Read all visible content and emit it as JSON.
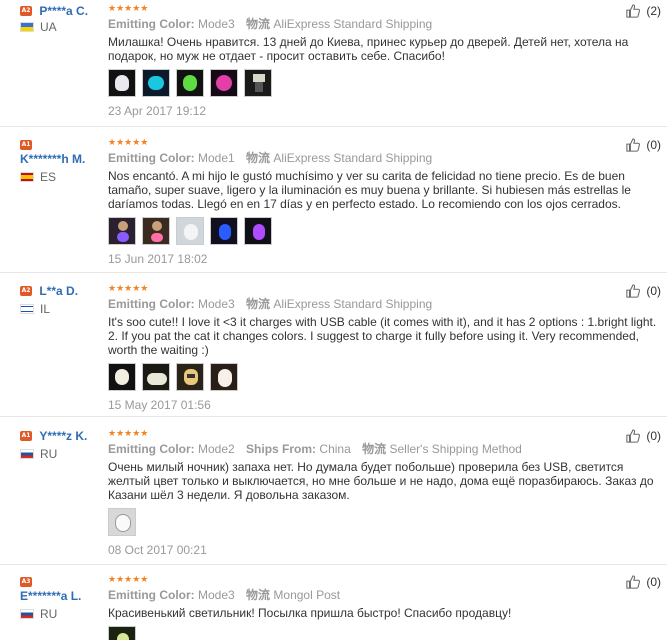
{
  "labels": {
    "emitting_color": "Emitting Color:",
    "ships_from": "Ships From:",
    "logistics_glyph": "物流"
  },
  "reviews": [
    {
      "level": "A2",
      "name": "P****a C.",
      "country": "UA",
      "stars": "★★★★★",
      "color": "Mode3",
      "ships_from": "",
      "shipping": "AliExpress Standard Shipping",
      "text": "Милашка! Очень нравится. 13 дней до Киева, принес курьер до дверей. Детей нет, хотела на подарок, но муж не отдает - просит оставить себе. Спасибо!",
      "thumbs": 5,
      "date": "23 Apr 2017 19:12",
      "helpful": "(2)"
    },
    {
      "level": "A1",
      "name": "K*******h M.",
      "country": "ES",
      "stars": "★★★★★",
      "color": "Mode1",
      "ships_from": "",
      "shipping": "AliExpress Standard Shipping",
      "text": "Nos encantó. A mi hijo le gustó muchísimo y ver su carita de felicidad no tiene precio. Es de buen tamaño, super suave, ligero y la iluminación es muy buena y brillante. Si hubiesen más estrellas le daríamos todas. Llegó en en 17 días y en perfecto estado. Lo recomiendo con los ojos cerrados.",
      "thumbs": 5,
      "date": "15 Jun 2017 18:02",
      "helpful": "(0)"
    },
    {
      "level": "A2",
      "name": "L**a D.",
      "country": "IL",
      "stars": "★★★★★",
      "color": "Mode3",
      "ships_from": "",
      "shipping": "AliExpress Standard Shipping",
      "text": "It's soo cute!! I love it <3 it charges with USB cable (it comes with it), and it has 2 options : 1.bright light. 2. If you pat the cat it changes colors. I suggest to charge it fully before using it. Very recommended, worth the waiting :)",
      "thumbs": 4,
      "date": "15 May 2017 01:56",
      "helpful": "(0)"
    },
    {
      "level": "A1",
      "name": "Y****z K.",
      "country": "RU",
      "stars": "★★★★★",
      "color": "Mode2",
      "ships_from": "China",
      "shipping": "Seller's Shipping Method",
      "text": "Очень милый ночник) запаха нет. Но думала будет побольше) проверила без USB, светится желтый цвет только и выключается, но мне больше и не надо, дома ещё поразбираюсь. Заказ до Казани шёл 3 недели. Я довольна заказом.",
      "thumbs": 1,
      "date": "08 Oct 2017 00:21",
      "helpful": "(0)"
    },
    {
      "level": "A3",
      "name": "E*******a L.",
      "country": "RU",
      "stars": "★★★★★",
      "color": "Mode3",
      "ships_from": "",
      "shipping": "Mongol Post",
      "text": "Красивенький светильник! Посылка пришла быстро! Спасибо продавцу!",
      "thumbs": 1,
      "date": "",
      "helpful": "(0)"
    }
  ]
}
